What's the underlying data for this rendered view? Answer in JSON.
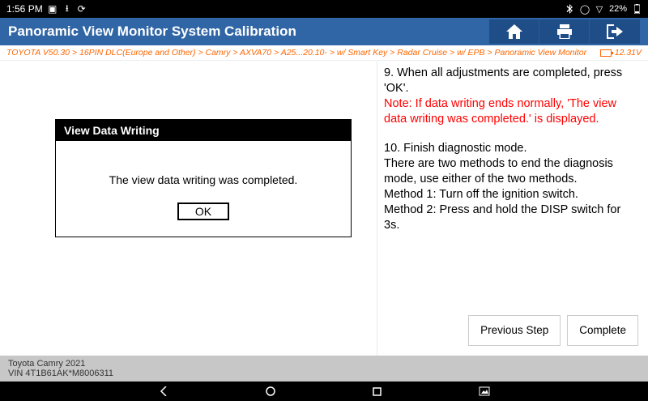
{
  "status": {
    "time": "1:56 PM",
    "battery": "22%"
  },
  "header": {
    "title": "Panoramic View Monitor System Calibration"
  },
  "breadcrumb": {
    "path": "TOYOTA V50.30 > 16PIN DLC(Europe and Other) > Camry > AXVA70 > A25...20.10- > w/ Smart Key > Radar Cruise > w/ EPB > Panoramic View Monitor",
    "voltage": "12.31V"
  },
  "dialog": {
    "title": "View Data Writing",
    "message": "The view data writing was completed.",
    "ok": "OK"
  },
  "instructions": {
    "step9": "9. When all adjustments are completed, press 'OK'.",
    "note": "Note: If data writing ends normally, 'The view data writing was completed.' is displayed.",
    "step10a": "10. Finish diagnostic mode.",
    "step10b": "There are two methods to end the diagnosis mode, use either of the two methods.",
    "method1": "Method 1: Turn off the ignition switch.",
    "method2": "Method 2: Press and hold the DISP switch for 3s."
  },
  "buttons": {
    "prev": "Previous Step",
    "complete": "Complete"
  },
  "footer": {
    "vehicle": "Toyota Camry 2021",
    "vin": "VIN 4T1B61AK*M8006311"
  }
}
